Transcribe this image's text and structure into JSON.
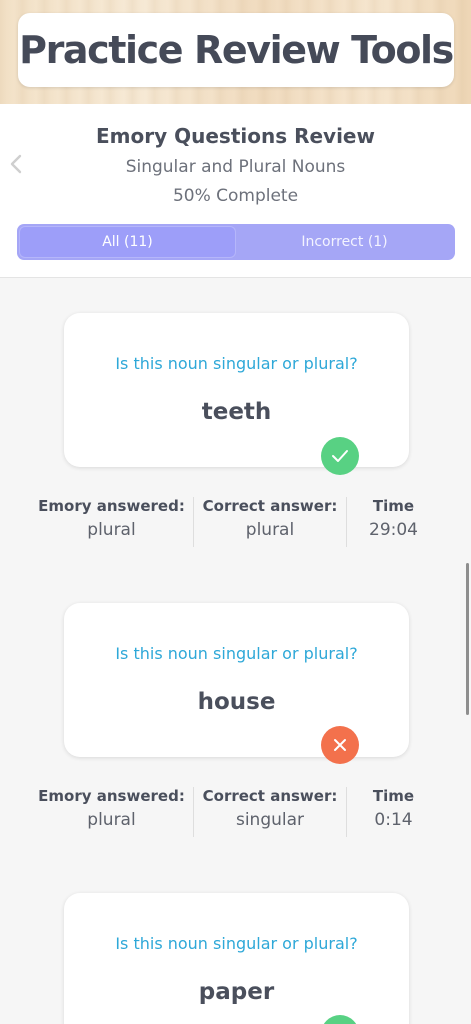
{
  "banner": {
    "title": "Practice Review Tools"
  },
  "header": {
    "title": "Emory Questions Review",
    "subtitle": "Singular and Plural Nouns",
    "progress": "50% Complete",
    "tabs": [
      {
        "label": "All (11)",
        "active": true
      },
      {
        "label": "Incorrect (1)",
        "active": false
      }
    ]
  },
  "labels": {
    "answered": "Emory answered:",
    "correct": "Correct answer:",
    "time": "Time"
  },
  "questions": [
    {
      "prompt": "Is this noun singular or plural?",
      "word": "teeth",
      "status": "correct",
      "answered": "plural",
      "correct_answer": "plural",
      "time": "29:04"
    },
    {
      "prompt": "Is this noun singular or plural?",
      "word": "house",
      "status": "incorrect",
      "answered": "plural",
      "correct_answer": "singular",
      "time": "0:14"
    },
    {
      "prompt": "Is this noun singular or plural?",
      "word": "paper",
      "status": "correct"
    }
  ],
  "colors": {
    "accent": "#a5a6f6",
    "prompt": "#2ea8d8",
    "correct": "#58d183",
    "incorrect": "#f3714c"
  }
}
